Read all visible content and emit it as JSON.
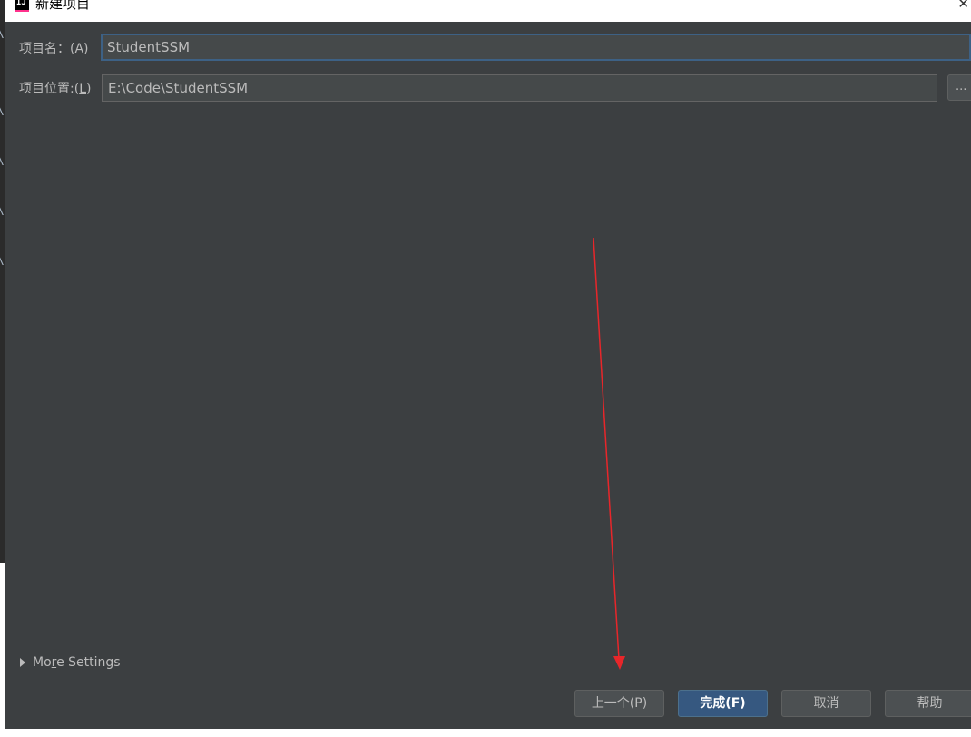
{
  "window": {
    "title": "新建项目",
    "app_icon_text": "IJ",
    "close_glyph": "✕"
  },
  "form": {
    "name_label_prefix": "项目名：(",
    "name_label_key": "A",
    "name_label_suffix": ")",
    "name_value": "StudentSSM",
    "location_label_prefix": "项目位置:(",
    "location_label_key": "L",
    "location_label_suffix": ")",
    "location_value": "E:\\Code\\StudentSSM",
    "browse_label": "..."
  },
  "more_settings": {
    "label_before": "Mo",
    "label_key": "r",
    "label_after": "e Settings"
  },
  "buttons": {
    "previous": "上一个(P)",
    "finish": "完成(F)",
    "cancel": "取消",
    "help": "帮助"
  },
  "colors": {
    "background": "#3c3f41",
    "primary_button": "#365880",
    "focus_border": "#3d6185",
    "annotation_arrow": "#e8262a"
  },
  "annotation": {
    "type": "red-arrow",
    "points_to": "finish-button"
  }
}
